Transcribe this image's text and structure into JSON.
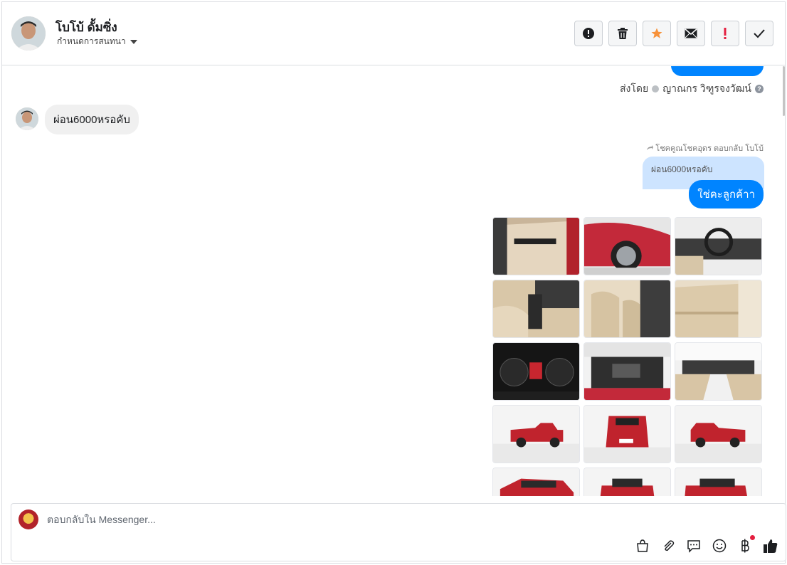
{
  "header": {
    "contact_name": "โบโบ้ ดั้มซิ่ง",
    "assign_label": "กำหนดการสนทนา",
    "actions": [
      {
        "icon": "alert-circle-icon"
      },
      {
        "icon": "trash-icon"
      },
      {
        "icon": "star-icon"
      },
      {
        "icon": "envelope-icon"
      },
      {
        "icon": "exclamation-icon"
      },
      {
        "icon": "check-icon"
      }
    ]
  },
  "thread": {
    "sent_by_prefix": "ส่งโดย",
    "sent_by_name": "ญาณกร วิฑูรจงวัฒน์",
    "incoming_message": "ผ่อน6000หรอคับ",
    "reply_meta": "โชคคูณโชคอุดร ตอบกลับ โบโบ้",
    "quoted_text": "ผ่อน6000หรอคับ",
    "outgoing_message": "ใช่คะลูกค้าา",
    "photos": [
      {
        "subject": "door-interior"
      },
      {
        "subject": "front-wheel"
      },
      {
        "subject": "dashboard"
      },
      {
        "subject": "gear-console"
      },
      {
        "subject": "front-seats"
      },
      {
        "subject": "rear-seats"
      },
      {
        "subject": "gauge-cluster"
      },
      {
        "subject": "engine-bay"
      },
      {
        "subject": "cabin-overview"
      },
      {
        "subject": "side-view"
      },
      {
        "subject": "rear-view"
      },
      {
        "subject": "side-view-right"
      },
      {
        "subject": "front-angle"
      },
      {
        "subject": "rear-angle"
      },
      {
        "subject": "rear-angle-2"
      }
    ]
  },
  "composer": {
    "placeholder": "ตอบกลับใน Messenger...",
    "tools": [
      "bag-icon",
      "paperclip-icon",
      "chat-bubble-icon",
      "smiley-icon",
      "baht-icon",
      "thumbs-up-icon"
    ]
  },
  "colors": {
    "messenger_blue": "#0084ff",
    "quote_bg": "#cde4ff",
    "incoming_bg": "#f0f0f0",
    "star": "#f7923a",
    "alert_red": "#e41e3f"
  }
}
